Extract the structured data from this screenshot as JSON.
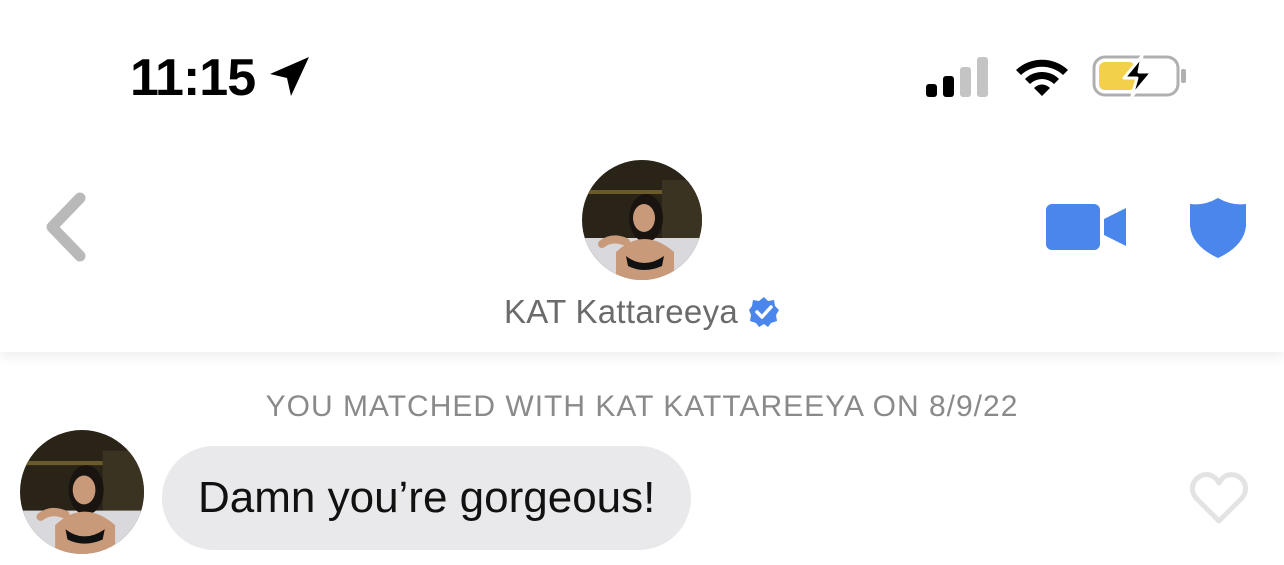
{
  "status_bar": {
    "time": "11:15",
    "icons": [
      "location-arrow-icon",
      "cellular-signal-icon",
      "wifi-icon",
      "battery-charging-icon"
    ],
    "battery_color": "#f3d04a"
  },
  "header": {
    "back_icon": "chevron-left-icon",
    "profile_name": "KAT Kattareeya",
    "verified_icon": "verified-badge-icon",
    "video_icon": "video-camera-icon",
    "safety_icon": "shield-icon",
    "accent_color": "#4a86ec"
  },
  "chat": {
    "match_notice": "YOU MATCHED WITH KAT KATTAREEYA ON 8/9/22",
    "messages": [
      {
        "text": "Damn you’re gorgeous!",
        "like_icon": "heart-outline-icon"
      }
    ]
  }
}
